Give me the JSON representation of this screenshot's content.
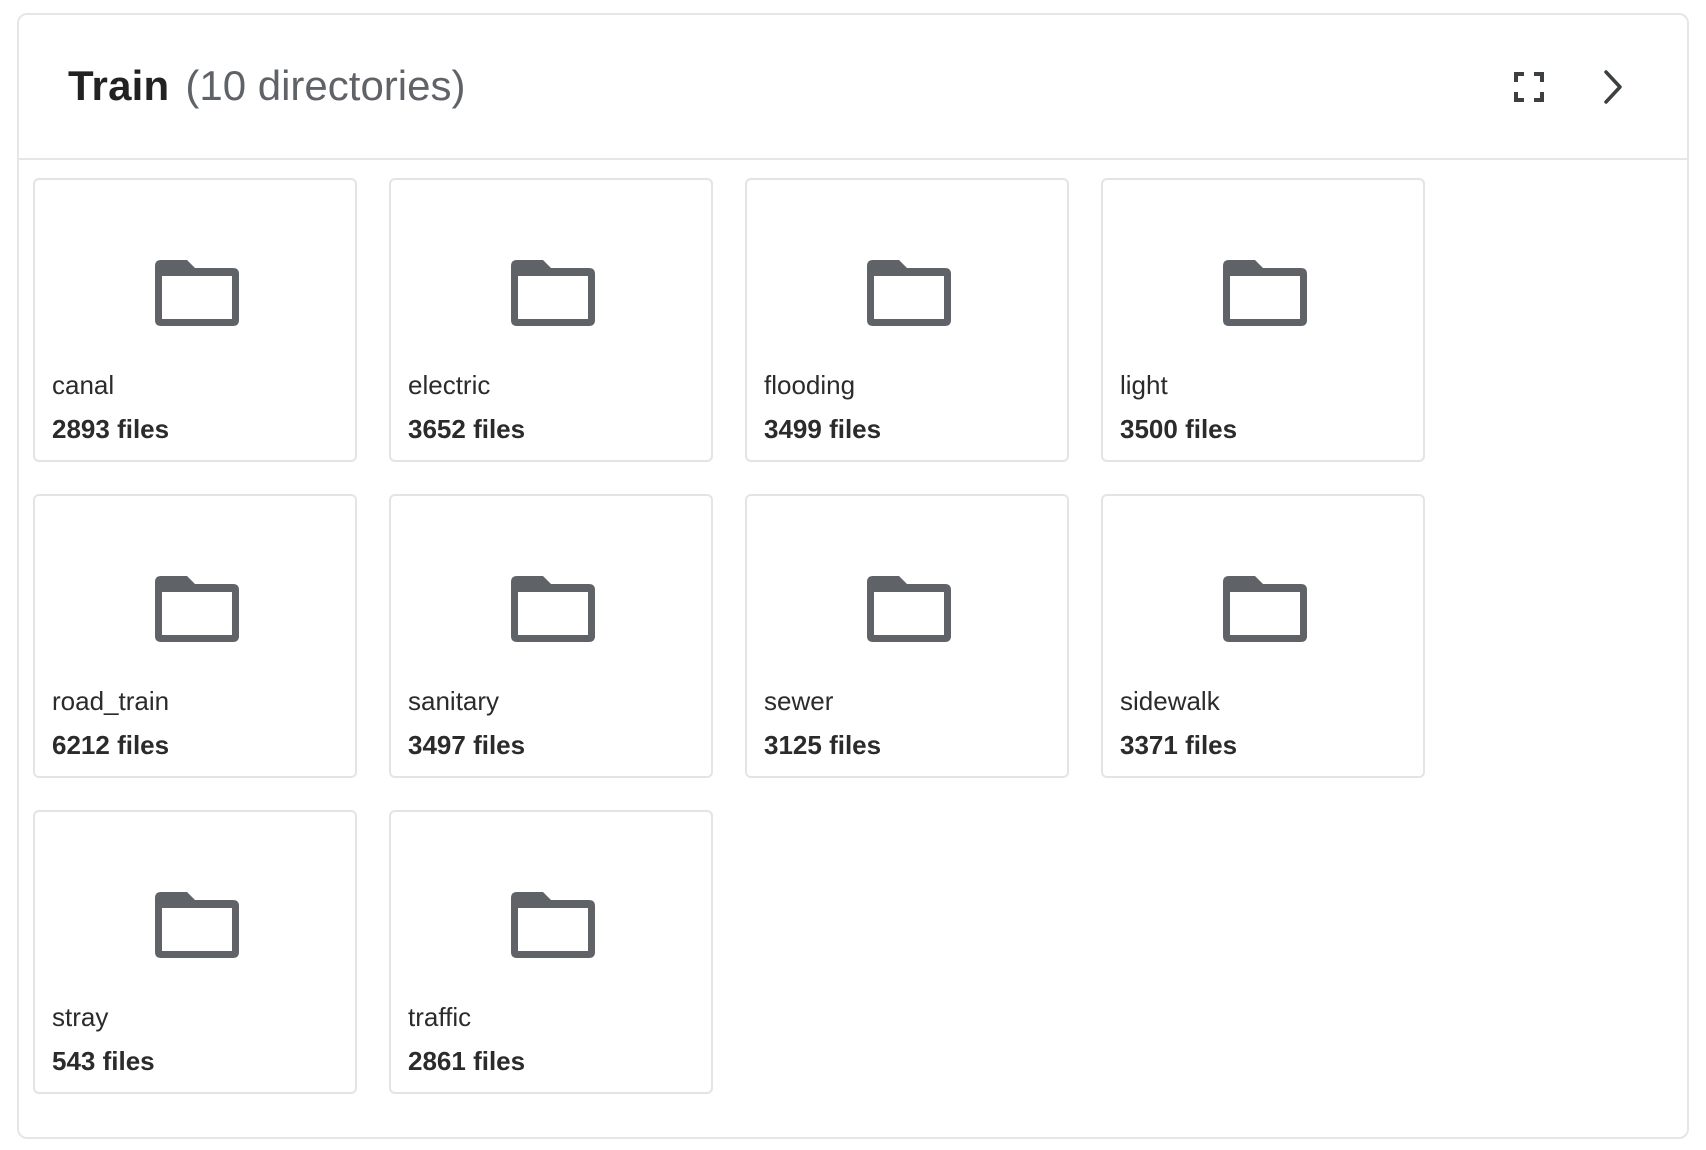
{
  "panel": {
    "title": "Train",
    "subtitle": "(10 directories)"
  },
  "header_icons": {
    "expand": "fullscreen-icon",
    "next": "chevron-right-icon"
  },
  "colors": {
    "folder": "#5f6368",
    "border": "#e6e6e6",
    "text": "#2b2b2b"
  },
  "directories": [
    {
      "name": "canal",
      "count": "2893 files"
    },
    {
      "name": "electric",
      "count": "3652 files"
    },
    {
      "name": "flooding",
      "count": "3499 files"
    },
    {
      "name": "light",
      "count": "3500 files"
    },
    {
      "name": "road_train",
      "count": "6212 files"
    },
    {
      "name": "sanitary",
      "count": "3497 files"
    },
    {
      "name": "sewer",
      "count": "3125 files"
    },
    {
      "name": "sidewalk",
      "count": "3371 files"
    },
    {
      "name": "stray",
      "count": "543 files"
    },
    {
      "name": "traffic",
      "count": "2861 files"
    }
  ]
}
